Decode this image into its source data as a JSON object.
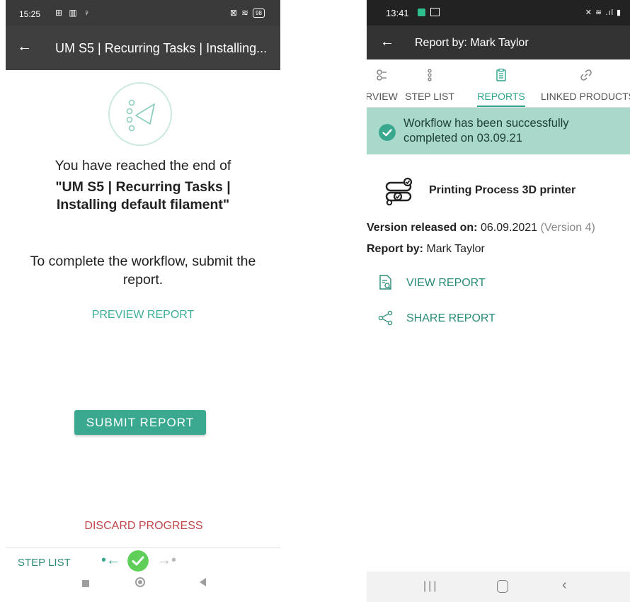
{
  "left": {
    "status_time": "15:25",
    "status_icons_left": "⊞ ▥ ♀",
    "battery": "98",
    "appbar_title": "UM S5 | Recurring Tasks | Installing...",
    "reached_text": "You have reached the end of",
    "workflow_name": "\"UM S5 | Recurring Tasks | Installing default filament\"",
    "complete_text": "To complete the workflow, submit the report.",
    "preview_label": "PREVIEW REPORT",
    "submit_label": "SUBMIT REPORT",
    "discard_label": "DISCARD PROGRESS",
    "step_list_label": "STEP LIST",
    "icons": [
      "back-arrow-icon",
      "send-list-icon",
      "prev-arrow-icon",
      "check-icon",
      "next-arrow-icon"
    ],
    "accent": "#3aa98f",
    "danger": "#c0464c"
  },
  "right": {
    "status_time": "13:41",
    "status_icons_right": "✕ ≋ .ıl ▮",
    "appbar_title": "Report by: Mark Taylor",
    "tabs": [
      {
        "label": "RVIEW",
        "icon": "overview-icon"
      },
      {
        "label": "STEP LIST",
        "icon": "step-list-icon"
      },
      {
        "label": "REPORTS",
        "icon": "clipboard-icon"
      },
      {
        "label": "LINKED PRODUCTS",
        "icon": "link-icon"
      }
    ],
    "active_tab": "REPORTS",
    "banner_text": "Workflow has been successfully completed on 03.09.21",
    "process_title": "Printing Process 3D printer",
    "version_label": "Version released on:",
    "version_date": "06.09.2021",
    "version_number": "(Version 4)",
    "report_by_label": "Report by:",
    "report_by_name": "Mark Taylor",
    "view_report_label": "VIEW REPORT",
    "share_report_label": "SHARE REPORT",
    "accent": "#2ea48a",
    "banner_color": "#a9d9cb"
  }
}
